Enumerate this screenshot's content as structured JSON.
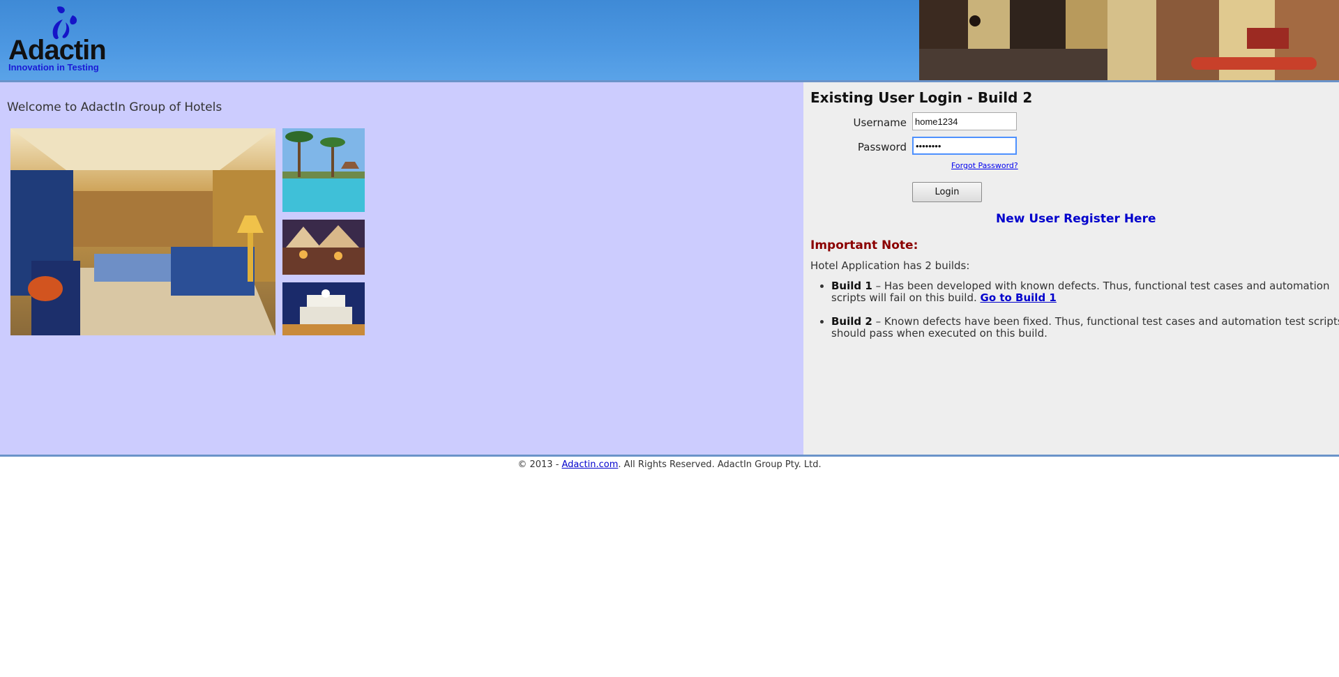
{
  "header": {
    "logo_word": "Adactin",
    "logo_tagline": "Innovation in Testing"
  },
  "left": {
    "welcome": "Welcome to AdactIn Group of Hotels"
  },
  "login": {
    "title": "Existing User Login - Build 2",
    "username_label": "Username",
    "username_value": "home1234",
    "password_label": "Password",
    "password_value": "••••••••",
    "forgot_link": "Forgot Password?",
    "login_button": "Login",
    "new_user_link": "New User Register Here"
  },
  "note": {
    "heading": "Important Note:",
    "intro": "Hotel Application has 2 builds:",
    "build1_name": "Build 1",
    "build1_text": " – Has been developed with known defects. Thus, functional test cases and automation scripts will fail on this build. ",
    "build1_link": "Go to Build 1",
    "build2_name": "Build 2",
    "build2_text": " – Known defects have been fixed. Thus, functional test cases and automation test scripts should pass when executed on this build."
  },
  "footer": {
    "prefix": "© 2013 - ",
    "link": "Adactin.com",
    "suffix": ". All Rights Reserved. AdactIn Group Pty. Ltd."
  },
  "colors": {
    "header_blue": "#4d98e2",
    "left_panel": "#ccccfe",
    "right_panel": "#eeeeee",
    "link_blue": "#0000cc",
    "note_red": "#8b0000"
  }
}
